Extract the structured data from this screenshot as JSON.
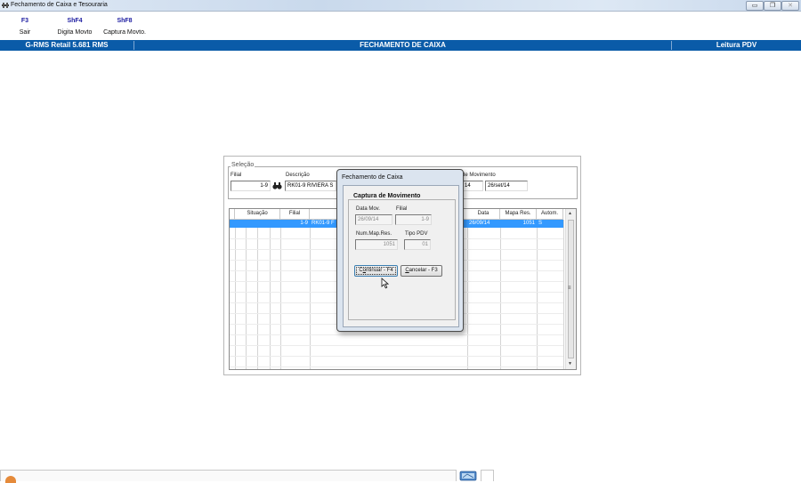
{
  "window": {
    "title": "Fechamento de Caixa e Tesouraria",
    "buttons": {
      "minimize": "▭",
      "restore": "❐",
      "close": "✕"
    }
  },
  "toolbar": [
    {
      "key": "F3",
      "label": "Sair"
    },
    {
      "key": "ShF4",
      "label": "Digita Movto"
    },
    {
      "key": "ShF8",
      "label": "Captura Movto."
    }
  ],
  "header": {
    "left": "G-RMS Retail 5.681 RMS",
    "center": "FECHAMENTO DE CAIXA",
    "right": "Leitura PDV",
    "color": "#0a5ba8"
  },
  "selection": {
    "legend": "Seleção",
    "filial_label": "Filial",
    "filial_value": "1-9",
    "descricao_label": "Descrição",
    "descricao_value": "RK01-9 RIVIERA S",
    "data_mov_label": "de Movimento",
    "data_short": "14",
    "data_value": "26/set/14"
  },
  "grid": {
    "columns": [
      "Situação",
      "Filial",
      "Data",
      "Mapa Res.",
      "Autom."
    ],
    "rows": [
      {
        "filial": "1-9",
        "descricao": "RK01-9 F",
        "data": "26/09/14",
        "mapa": "1051",
        "autom": "S"
      }
    ],
    "selected_color": "#3399ff"
  },
  "dialog": {
    "title": "Fechamento de Caixa",
    "group_title": "Captura de Movimento",
    "data_mov_label": "Data Mov.",
    "data_mov_value": "26/09/14",
    "filial_label": "Filial",
    "filial_value": "1-9",
    "num_map_label": "Num.Map.Res.",
    "num_map_value": "1051",
    "tipo_pdv_label": "Tipo PDV",
    "tipo_pdv_value": "01",
    "continue_pre": "C",
    "continue_u": "o",
    "continue_post": "ntinuar - F4",
    "cancel_u": "C",
    "cancel_post": "ancelar - F3"
  }
}
